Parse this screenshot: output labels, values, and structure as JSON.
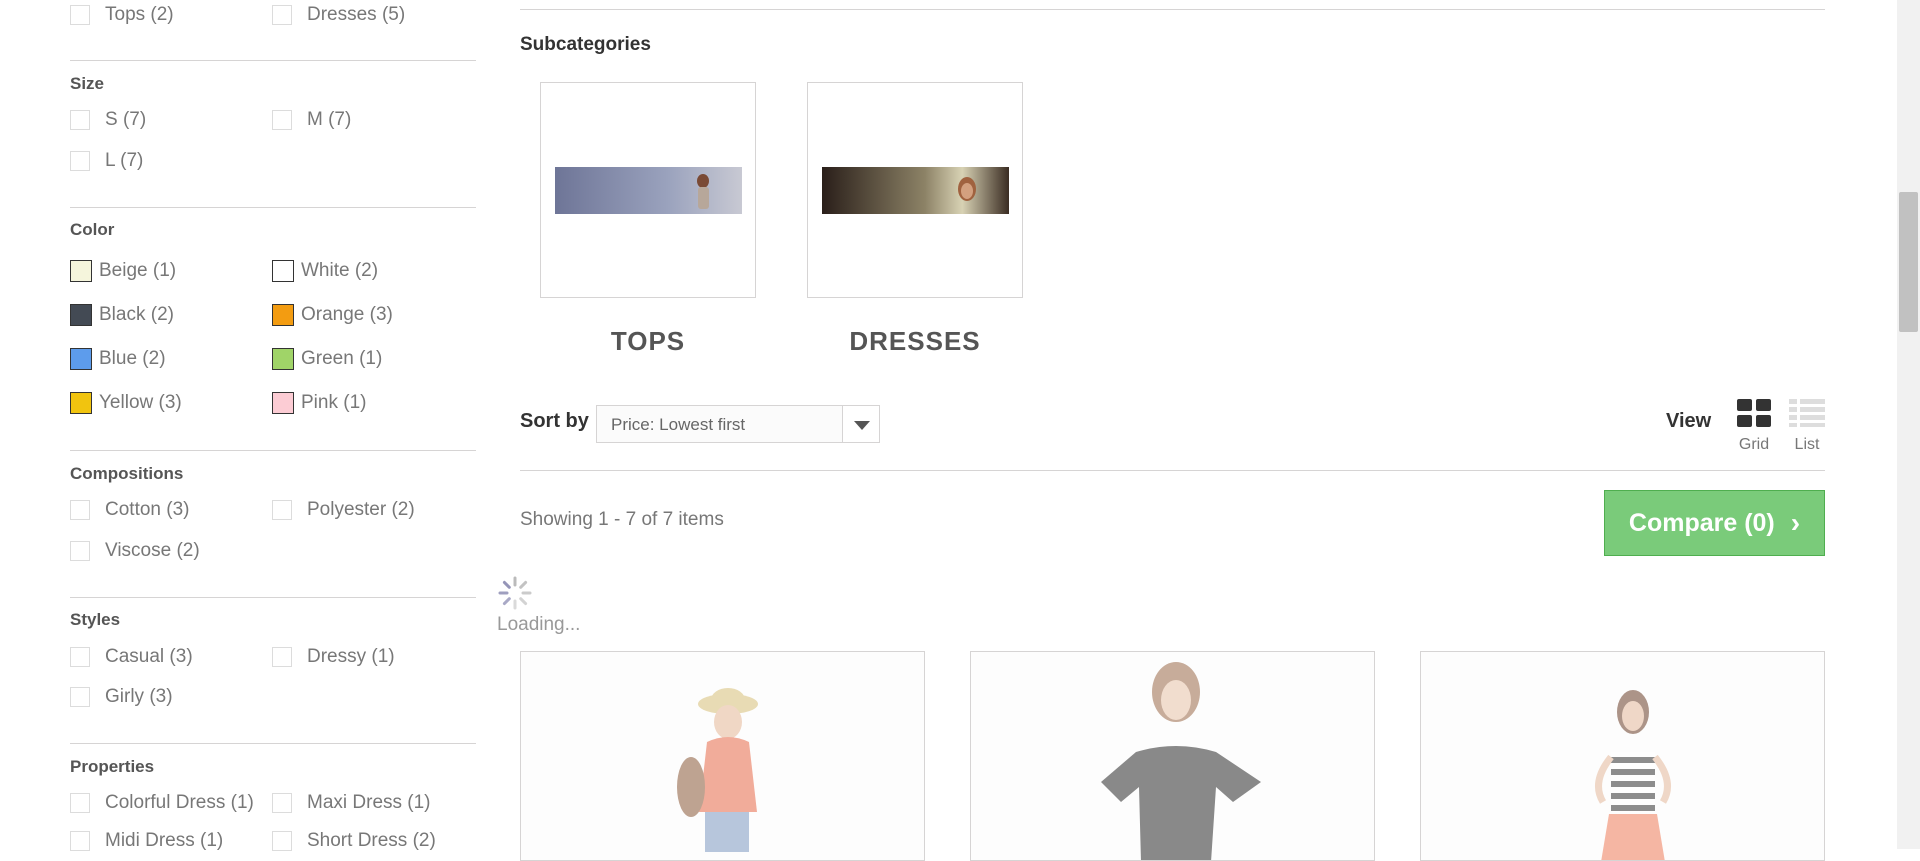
{
  "filters": {
    "categories": [
      {
        "label": "Tops (2)"
      },
      {
        "label": "Dresses (5)"
      }
    ],
    "size": {
      "title": "Size",
      "options": [
        {
          "label": "S (7)"
        },
        {
          "label": "M (7)"
        },
        {
          "label": "L (7)"
        }
      ]
    },
    "color": {
      "title": "Color",
      "options": [
        {
          "label": "Beige (1)",
          "swatch": "#f5f5dc"
        },
        {
          "label": "White (2)",
          "swatch": "#ffffff"
        },
        {
          "label": "Black (2)",
          "swatch": "#434a54"
        },
        {
          "label": "Orange (3)",
          "swatch": "#f39c11"
        },
        {
          "label": "Blue (2)",
          "swatch": "#5d9cec"
        },
        {
          "label": "Green (1)",
          "swatch": "#a0d468"
        },
        {
          "label": "Yellow (3)",
          "swatch": "#f1c40f"
        },
        {
          "label": "Pink (1)",
          "swatch": "#fcccd4"
        }
      ]
    },
    "compositions": {
      "title": "Compositions",
      "options": [
        {
          "label": "Cotton (3)"
        },
        {
          "label": "Polyester (2)"
        },
        {
          "label": "Viscose (2)"
        }
      ]
    },
    "styles": {
      "title": "Styles",
      "options": [
        {
          "label": "Casual (3)"
        },
        {
          "label": "Dressy (1)"
        },
        {
          "label": "Girly (3)"
        }
      ]
    },
    "properties": {
      "title": "Properties",
      "options": [
        {
          "label": "Colorful Dress (1)"
        },
        {
          "label": "Maxi Dress (1)"
        },
        {
          "label": "Midi Dress (1)"
        },
        {
          "label": "Short Dress (2)"
        }
      ]
    }
  },
  "subcategories": {
    "title": "Subcategories",
    "items": [
      {
        "name": "TOPS"
      },
      {
        "name": "DRESSES"
      }
    ]
  },
  "toolbar": {
    "sort_label": "Sort by",
    "sort_value": "Price: Lowest first",
    "view_label": "View",
    "view_grid": "Grid",
    "view_list": "List"
  },
  "results": {
    "showing": "Showing 1 - 7 of 7 items",
    "compare_label": "Compare (0)",
    "loading": "Loading..."
  },
  "colors": {
    "compare_bg": "#7acb7a",
    "compare_border": "#4fae4f"
  }
}
